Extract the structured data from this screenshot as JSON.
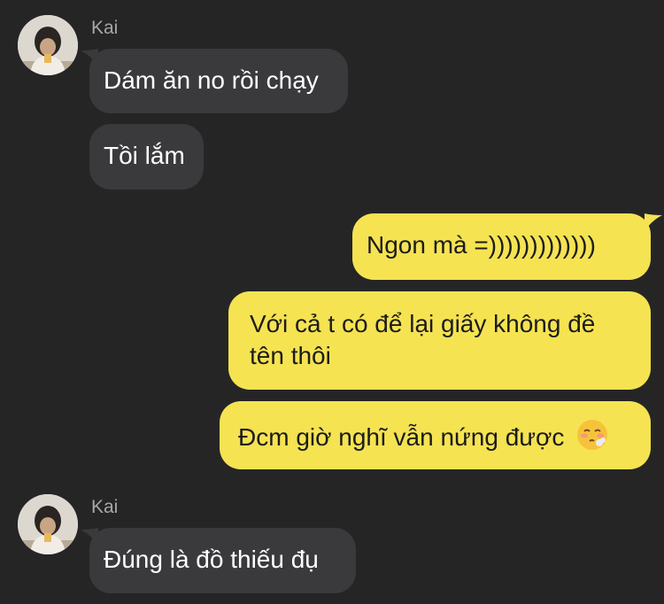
{
  "messages": [
    {
      "sender": "Kai",
      "text": "Dám ăn no rồi chạy",
      "direction": "incoming"
    },
    {
      "text": "Tồi lắm",
      "direction": "incoming"
    },
    {
      "text": "Ngon mà =)))))))))))))",
      "direction": "outgoing"
    },
    {
      "text_line1": "Với cả t có để lại giấy không đề",
      "text_line2": "tên thôi",
      "direction": "outgoing"
    },
    {
      "text": "Đcm giờ nghĩ vẫn nứng được",
      "emoji": "face-exhaling-icon",
      "direction": "outgoing"
    },
    {
      "sender": "Kai",
      "text": "Đúng là đồ thiếu đụ",
      "direction": "incoming"
    }
  ],
  "colors": {
    "background": "#252526",
    "incoming_bubble": "#3a3a3d",
    "outgoing_bubble": "#f5e352"
  }
}
